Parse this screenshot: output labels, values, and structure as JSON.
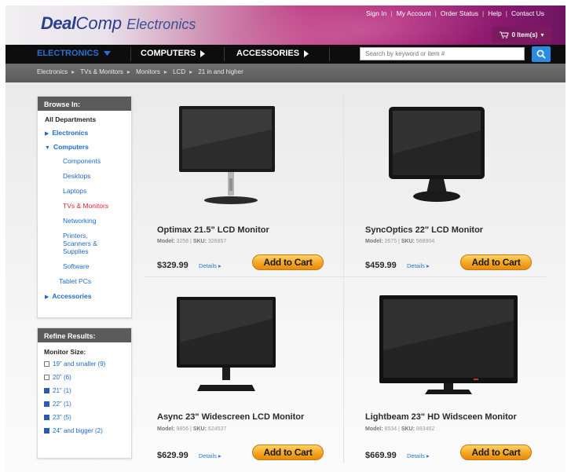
{
  "brand": {
    "part1": "Deal",
    "part2": "Comp",
    "part3": "Electronics"
  },
  "toplinks": [
    "Sign In",
    "My Account",
    "Order Status",
    "Help",
    "Contact Us"
  ],
  "cart": {
    "label": "0 Item(s)"
  },
  "nav": {
    "items": [
      {
        "label": "ELECTRONICS"
      },
      {
        "label": "COMPUTERS"
      },
      {
        "label": "ACCESSORIES"
      }
    ]
  },
  "search": {
    "placeholder": "Search by keyword or item #"
  },
  "breadcrumb": [
    "Electronics",
    "TVs & Monitors",
    "Monitors",
    "LCD",
    "21 in and higher"
  ],
  "browse": {
    "title": "Browse In:",
    "root": "All Departments",
    "electronics": "Electronics",
    "computers": "Computers",
    "sub": [
      "Components",
      "Desktops",
      "Laptops",
      "TVs & Monitors",
      "Networking",
      "Printers, Scanners & Supplies",
      "Software",
      "Tablet PCs"
    ],
    "accessories": "Accessories"
  },
  "refine": {
    "title": "Refine Results:",
    "group": "Monitor Size:",
    "options": [
      {
        "label": "19\" and smaller (9)",
        "checked": false
      },
      {
        "label": "20\" (6)",
        "checked": false
      },
      {
        "label": "21\" (1)",
        "checked": true
      },
      {
        "label": "22\" (1)",
        "checked": true
      },
      {
        "label": "23\" (5)",
        "checked": true
      },
      {
        "label": "24\" and bigger (2)",
        "checked": true
      }
    ]
  },
  "products": [
    {
      "name": "Optimax 21.5\" LCD Monitor",
      "model_label": "Model:",
      "model": "3258",
      "sku_label": "SKU:",
      "sku": "326857",
      "price": "$329.99",
      "details": "Details",
      "cart": "Add to Cart"
    },
    {
      "name": "SyncOptics 22\" LCD Monitor",
      "model_label": "Model:",
      "model": "2675",
      "sku_label": "SKU:",
      "sku": "568904",
      "price": "$459.99",
      "details": "Details",
      "cart": "Add to Cart"
    },
    {
      "name": "Async 23\" Widescreen LCD Monitor",
      "model_label": "Model:",
      "model": "9856",
      "sku_label": "SKU:",
      "sku": "624537",
      "price": "$629.99",
      "details": "Details",
      "cart": "Add to Cart"
    },
    {
      "name": "Lightbeam 23\" HD Widsceen Monitor",
      "model_label": "Model:",
      "model": "6534",
      "sku_label": "SKU:",
      "sku": "893462",
      "price": "$669.99",
      "details": "Details",
      "cart": "Add to Cart"
    }
  ]
}
